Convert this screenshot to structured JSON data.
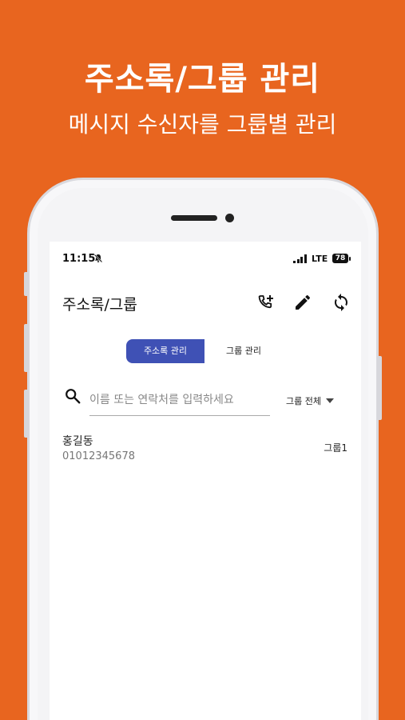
{
  "promo": {
    "title": "주소록/그룹 관리",
    "subtitle": "메시지 수신자를 그룹별 관리"
  },
  "status_bar": {
    "time": "11:15",
    "network": "LTE",
    "battery": "78"
  },
  "app_bar": {
    "title": "주소록/그룹",
    "icons": [
      "add-call-icon",
      "edit-icon",
      "sync-icon"
    ]
  },
  "tabs": [
    {
      "label": "주소록 관리",
      "active": true
    },
    {
      "label": "그룹 관리",
      "active": false
    }
  ],
  "search": {
    "placeholder": "이름 또는 연락처를 입력하세요",
    "value": ""
  },
  "group_filter": {
    "selected": "그룹 전체"
  },
  "contacts": [
    {
      "name": "홍길동",
      "phone": "01012345678",
      "group": "그룹1"
    }
  ],
  "colors": {
    "background": "#E8651F",
    "accent": "#3F51B5"
  }
}
